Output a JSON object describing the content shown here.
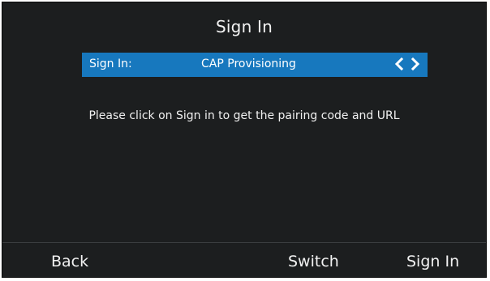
{
  "screen": {
    "title": "Sign In"
  },
  "option": {
    "label": "Sign In:",
    "value": "CAP Provisioning",
    "prev_icon": "chevron-left-icon",
    "next_icon": "chevron-right-icon"
  },
  "message": "Please click on Sign in to get the pairing code and URL",
  "softkeys": {
    "back": "Back",
    "switch": "Switch",
    "signin": "Sign In"
  },
  "colors": {
    "background": "#1c1e1f",
    "highlight": "#1778be",
    "text": "#ffffff"
  }
}
